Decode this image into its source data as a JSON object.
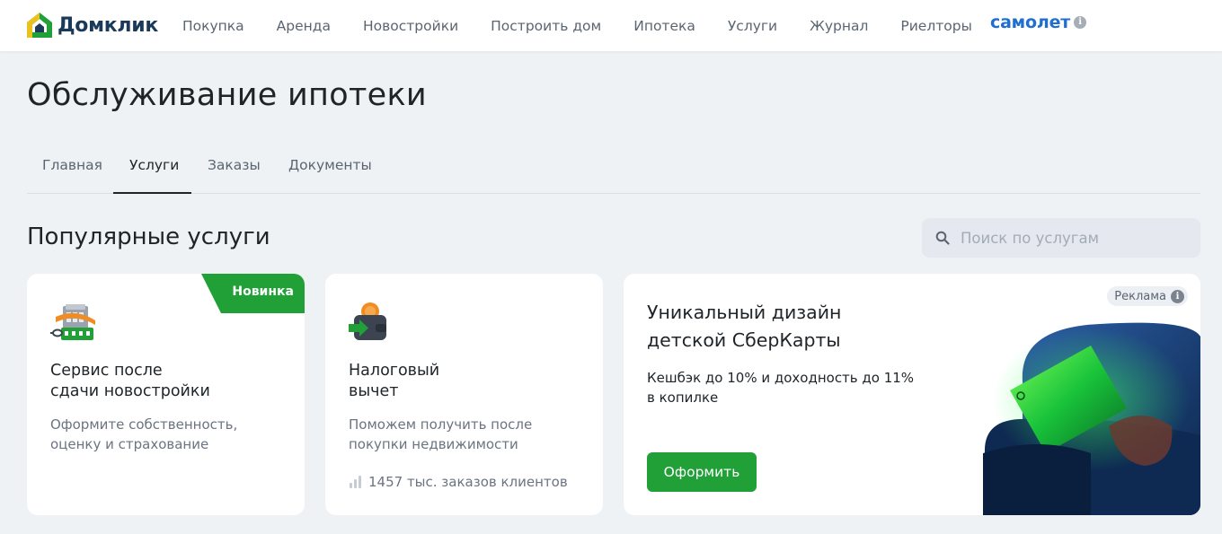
{
  "header": {
    "brand": "Домклик",
    "nav": [
      "Покупка",
      "Аренда",
      "Новостройки",
      "Построить дом",
      "Ипотека",
      "Услуги",
      "Журнал",
      "Риелторы"
    ],
    "partner": "самолет",
    "colors": {
      "brand_green": "#21a038",
      "brand_navy": "#1b3a5a",
      "partner_blue": "#1f6fd1"
    }
  },
  "page": {
    "title": "Обслуживание ипотеки"
  },
  "tabs": {
    "items": [
      "Главная",
      "Услуги",
      "Заказы",
      "Документы"
    ],
    "active": "Услуги"
  },
  "section": {
    "title": "Популярные услуги",
    "search_placeholder": "Поиск по услугам"
  },
  "cards": [
    {
      "icon": "building-icon",
      "badge": "Новинка",
      "title": "Сервис после\nсдачи новостройки",
      "description": "Оформите собственность,\nоценку и страхование"
    },
    {
      "icon": "wallet-coin-icon",
      "title": "Налоговый\nвычет",
      "description": "Поможем получить после\nпокупки недвижимости",
      "stat": "1457 тыс. заказов клиентов"
    }
  ],
  "ad": {
    "label": "Реклама",
    "title": "Уникальный дизайн\nдетской СберКарты",
    "description": "Кешбэк до 10% и доходность до 11%\nв копилке",
    "button": "Оформить",
    "image": "green-card-in-armchair-illustration"
  }
}
